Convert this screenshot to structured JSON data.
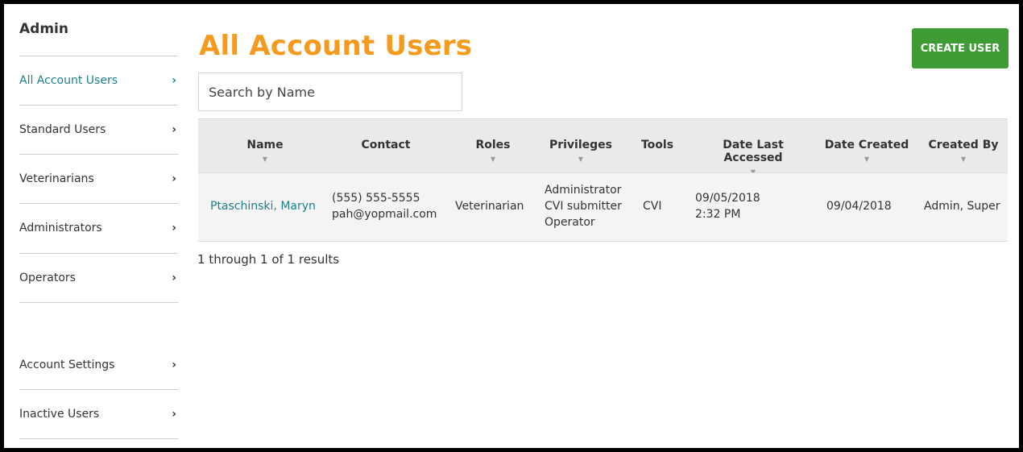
{
  "sidebar": {
    "title": "Admin",
    "items": [
      {
        "label": "All Account Users",
        "active": true
      },
      {
        "label": "Standard Users"
      },
      {
        "label": "Veterinarians"
      },
      {
        "label": "Administrators"
      },
      {
        "label": "Operators"
      },
      {
        "label": "Account Settings"
      },
      {
        "label": "Inactive Users"
      }
    ],
    "chevron": "›"
  },
  "main": {
    "title": "All Account Users",
    "create_button": "CREATE USER",
    "search_placeholder": "Search by Name",
    "table": {
      "columns": [
        {
          "label": "Name",
          "sortable": true
        },
        {
          "label": "Contact",
          "sortable": false
        },
        {
          "label": "Roles",
          "sortable": true
        },
        {
          "label": "Privileges",
          "sortable": true
        },
        {
          "label": "Tools",
          "sortable": false
        },
        {
          "label": "Date Last Accessed",
          "sortable": true
        },
        {
          "label": "Date Created",
          "sortable": true
        },
        {
          "label": "Created By",
          "sortable": true
        }
      ],
      "sort_glyph": "▼",
      "rows": [
        {
          "name": "Ptaschinski, Maryn",
          "contact_phone": "(555) 555-5555",
          "contact_email": "pah@yopmail.com",
          "roles": "Veterinarian",
          "privileges": [
            "Administrator",
            "CVI submitter",
            "Operator"
          ],
          "tools": "CVI",
          "date_last_accessed_date": "09/05/2018",
          "date_last_accessed_time": "2:32 PM",
          "date_created": "09/04/2018",
          "created_by": "Admin, Super"
        }
      ]
    },
    "results_text": "1 through 1 of 1 results"
  },
  "colors": {
    "title": "#f59a1d",
    "link": "#1b7f8c",
    "button": "#3f9c35"
  }
}
